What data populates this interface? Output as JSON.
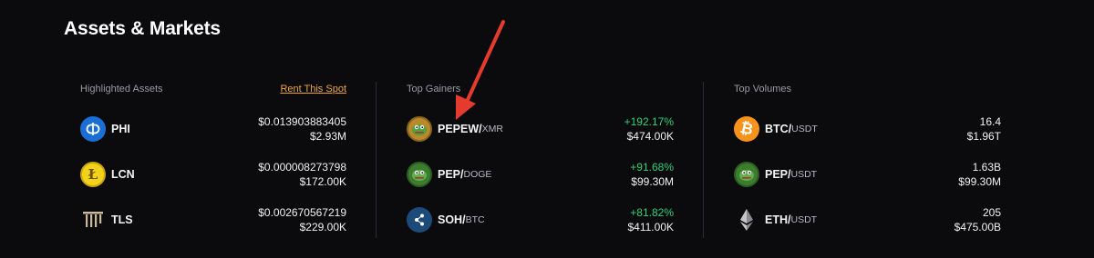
{
  "section": {
    "title": "Assets & Markets"
  },
  "highlighted": {
    "label": "Highlighted Assets",
    "rent_label": "Rent This Spot",
    "items": [
      {
        "symbol": "PHI",
        "price": "$0.013903883405",
        "volume": "$2.93M",
        "icon": "phi-coin-icon"
      },
      {
        "symbol": "LCN",
        "price": "$0.000008273798",
        "volume": "$172.00K",
        "icon": "lcn-coin-icon"
      },
      {
        "symbol": "TLS",
        "price": "$0.002670567219",
        "volume": "$229.00K",
        "icon": "tls-pillars-icon"
      }
    ]
  },
  "gainers": {
    "label": "Top Gainers",
    "items": [
      {
        "base": "PEPEW/",
        "quote": "XMR",
        "change": "+192.17%",
        "volume": "$474.00K",
        "icon": "pepew-coin-icon"
      },
      {
        "base": "PEP/",
        "quote": "DOGE",
        "change": "+91.68%",
        "volume": "$99.30M",
        "icon": "pep-coin-icon"
      },
      {
        "base": "SOH/",
        "quote": "BTC",
        "change": "+81.82%",
        "volume": "$411.00K",
        "icon": "soh-coin-icon"
      }
    ]
  },
  "volumes": {
    "label": "Top Volumes",
    "items": [
      {
        "base": "BTC/",
        "quote": "USDT",
        "amount": "16.4",
        "value": "$1.96T",
        "icon": "bitcoin-icon"
      },
      {
        "base": "PEP/",
        "quote": "USDT",
        "amount": "1.63B",
        "value": "$99.30M",
        "icon": "pep-coin-icon"
      },
      {
        "base": "ETH/",
        "quote": "USDT",
        "amount": "205",
        "value": "$475.00B",
        "icon": "ethereum-icon"
      }
    ]
  },
  "colors": {
    "accent": "#f0a542",
    "positive": "#2fd07a",
    "annotation_arrow": "#e53a2e"
  }
}
